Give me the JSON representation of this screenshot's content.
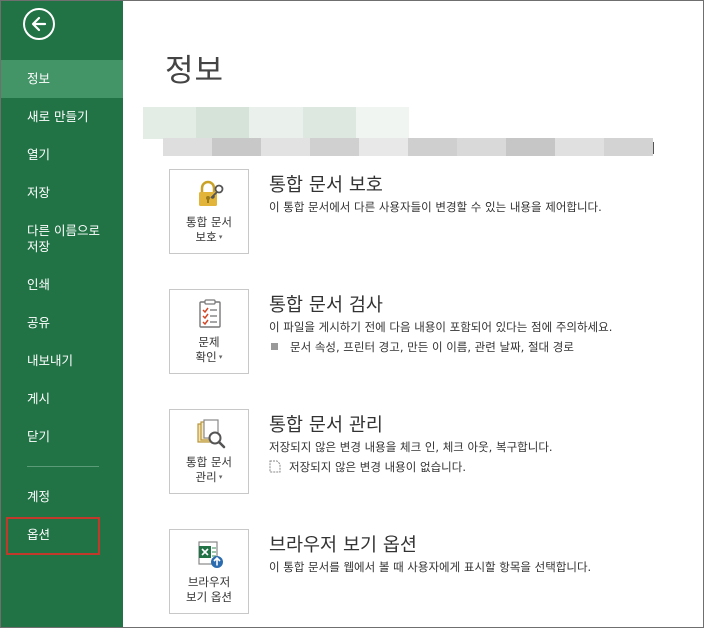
{
  "sidebar": {
    "items": [
      {
        "label": "정보",
        "active": true
      },
      {
        "label": "새로 만들기"
      },
      {
        "label": "열기"
      },
      {
        "label": "저장"
      },
      {
        "label": "다른 이름으로\n저장"
      },
      {
        "label": "인쇄"
      },
      {
        "label": "공유"
      },
      {
        "label": "내보내기"
      },
      {
        "label": "게시"
      },
      {
        "label": "닫기"
      },
      {
        "label": "계정"
      },
      {
        "label": "옵션",
        "highlighted": true
      }
    ]
  },
  "main": {
    "title": "정보",
    "sections": [
      {
        "card_line1": "통합 문서",
        "card_line2": "보호",
        "title": "통합 문서 보호",
        "description": "이 통합 문서에서 다른 사용자들이 변경할 수 있는 내용을 제어합니다.",
        "icon": "lock-key-icon"
      },
      {
        "card_line1": "문제",
        "card_line2": "확인",
        "title": "통합 문서 검사",
        "description": "이 파일을 게시하기 전에 다음 내용이 포함되어 있다는 점에 주의하세요.",
        "bullet": "문서 속성, 프린터 경고, 만든 이 이름, 관련 날짜, 절대 경로",
        "icon": "inspect-checklist-icon"
      },
      {
        "card_line1": "통합 문서",
        "card_line2": "관리",
        "title": "통합 문서 관리",
        "description": "저장되지 않은 변경 내용을 체크 인, 체크 아웃, 복구합니다.",
        "bullet": "저장되지 않은 변경 내용이 없습니다.",
        "icon": "manage-workbook-icon"
      },
      {
        "card_line1": "브라우저",
        "card_line2": "보기 옵션",
        "title": "브라우저 보기 옵션",
        "description": "이 통합 문서를 웹에서 볼 때 사용자에게 표시할 항목을 선택합니다.",
        "icon": "browser-excel-icon"
      }
    ]
  },
  "colors": {
    "sidebar": "#217346",
    "sidebar_active": "#439467",
    "highlight_box": "#c0392b"
  }
}
